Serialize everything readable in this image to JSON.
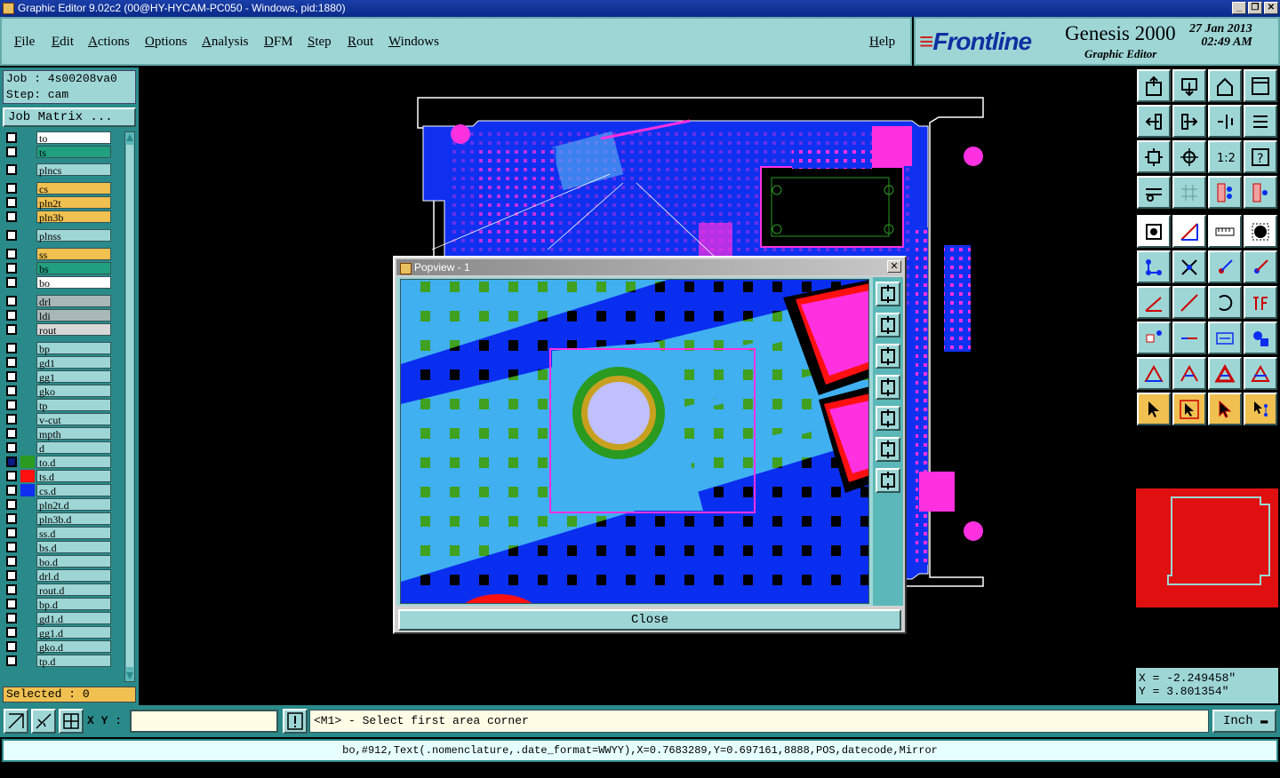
{
  "window": {
    "title": "Graphic Editor 9.02c2 (00@HY-HYCAM-PC050 - Windows, pid:1880)",
    "min": "_",
    "max": "❐",
    "close": "✕"
  },
  "menu": {
    "items": [
      "File",
      "Edit",
      "Actions",
      "Options",
      "Analysis",
      "DFM",
      "Step",
      "Rout",
      "Windows"
    ],
    "help": "Help"
  },
  "branding": {
    "brand": "Frontline",
    "product": "Genesis 2000",
    "subtitle": "Graphic Editor",
    "date": "27 Jan 2013",
    "time": "02:49 AM"
  },
  "job": {
    "job_line": "Job : 4s00208va0",
    "step_line": "Step: cam",
    "matrix_button": "Job Matrix ...",
    "selected": "Selected : 0"
  },
  "layers": [
    {
      "name": "to",
      "color": "#ffffff"
    },
    {
      "name": "ts",
      "color": "#20a080"
    },
    {
      "name": "plncs",
      "color": "#9ed6d6"
    },
    {
      "name": "cs",
      "color": "#f0c050"
    },
    {
      "name": "pln2t",
      "color": "#f0c050"
    },
    {
      "name": "pln3b",
      "color": "#f0c050"
    },
    {
      "name": "plnss",
      "color": "#9ed6d6"
    },
    {
      "name": "ss",
      "color": "#f0c050"
    },
    {
      "name": "bs",
      "color": "#20a080"
    },
    {
      "name": "bo",
      "color": "#ffffff"
    },
    {
      "name": "drl",
      "color": "#a8b8b8"
    },
    {
      "name": "ldi",
      "color": "#a8b8b8"
    },
    {
      "name": "rout",
      "color": "#d8d8d8"
    },
    {
      "name": "bp",
      "color": "#9ed6d6"
    },
    {
      "name": "gd1",
      "color": "#9ed6d6"
    },
    {
      "name": "gg1",
      "color": "#9ed6d6"
    },
    {
      "name": "gko",
      "color": "#9ed6d6"
    },
    {
      "name": "tp",
      "color": "#9ed6d6"
    },
    {
      "name": "v-cut",
      "color": "#9ed6d6"
    },
    {
      "name": "mpth",
      "color": "#9ed6d6"
    },
    {
      "name": "d",
      "color": "#9ed6d6"
    },
    {
      "name": "to.d",
      "color": "#9ed6d6",
      "swatch": "#2a9a20",
      "mark": "#0a1a80"
    },
    {
      "name": "ts.d",
      "color": "#9ed6d6",
      "swatch": "#ff1010"
    },
    {
      "name": "cs.d",
      "color": "#9ed6d6",
      "swatch": "#1030f0"
    },
    {
      "name": "pln2t.d",
      "color": "#9ed6d6"
    },
    {
      "name": "pln3b.d",
      "color": "#9ed6d6"
    },
    {
      "name": "ss.d",
      "color": "#9ed6d6"
    },
    {
      "name": "bs.d",
      "color": "#9ed6d6"
    },
    {
      "name": "bo.d",
      "color": "#9ed6d6"
    },
    {
      "name": "drl.d",
      "color": "#9ed6d6"
    },
    {
      "name": "rout.d",
      "color": "#9ed6d6"
    },
    {
      "name": "bp.d",
      "color": "#9ed6d6"
    },
    {
      "name": "gd1.d",
      "color": "#9ed6d6"
    },
    {
      "name": "gg1.d",
      "color": "#9ed6d6"
    },
    {
      "name": "gko.d",
      "color": "#9ed6d6"
    },
    {
      "name": "tp.d",
      "color": "#9ed6d6"
    }
  ],
  "popview": {
    "title": "Popview - 1",
    "close_label": "Close",
    "close_x": "✕"
  },
  "coords": {
    "x": "X = -2.249458\"",
    "y": "Y = 3.801354\""
  },
  "bottom": {
    "xy_label": "X Y :",
    "xy_value": "",
    "prompt": "<M1> - Select first area corner",
    "units": "Inch",
    "status": "bo,#912,Text(.nomenclature,.date_format=WWYY),X=0.7683289,Y=0.697161,8888,POS,datecode,Mirror"
  },
  "colors": {
    "panel": "#9ed6d6",
    "teal": "#2a8a8a",
    "board_blue": "#1030f0",
    "magenta": "#ff30e0",
    "highlight": "#f0c050"
  }
}
